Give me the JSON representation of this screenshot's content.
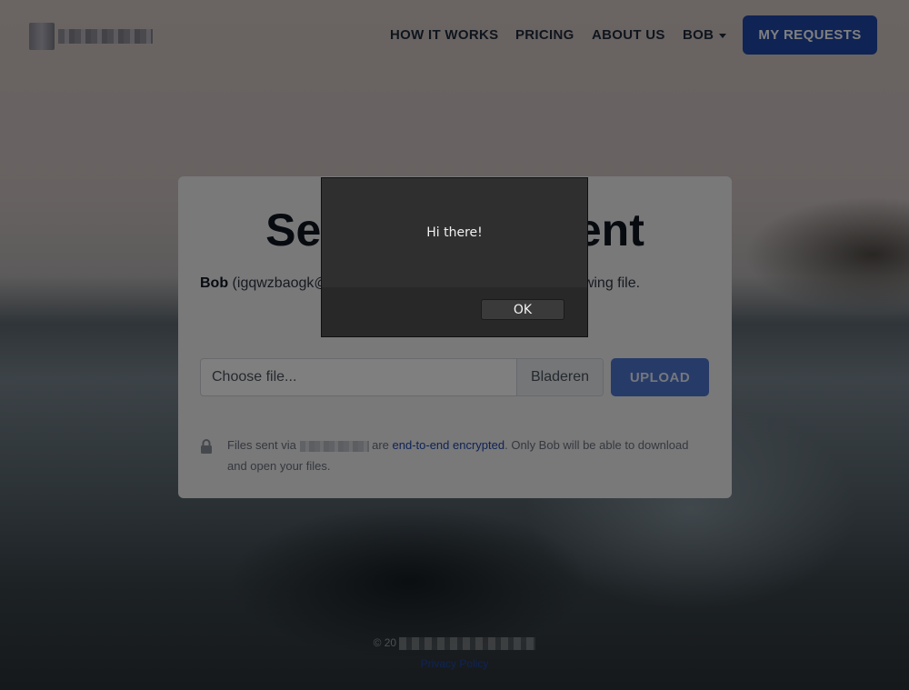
{
  "nav": {
    "items": [
      {
        "label": "HOW IT WORKS"
      },
      {
        "label": "PRICING"
      },
      {
        "label": "ABOUT US"
      },
      {
        "label": "BOB"
      }
    ],
    "cta": "MY REQUESTS"
  },
  "card": {
    "title": "Send a document",
    "sender": "Bob",
    "desc_rest": " (igqwzbaogk@... has requested you to upload the following file.",
    "file_placeholder": "Choose file...",
    "browse_label": "Bladeren",
    "upload_label": "UPLOAD",
    "note_before": "Files sent via",
    "note_mid": " are ",
    "note_link": "end-to-end encrypted",
    "note_after": ". Only Bob will be able to download and open your files."
  },
  "footer": {
    "copyright": "© 20",
    "privacy": "Privacy Policy"
  },
  "dialog": {
    "message": "Hi there!",
    "ok_label": "OK"
  },
  "colors": {
    "accent": "#1f47a8",
    "upload_button": "#4f76d1"
  }
}
